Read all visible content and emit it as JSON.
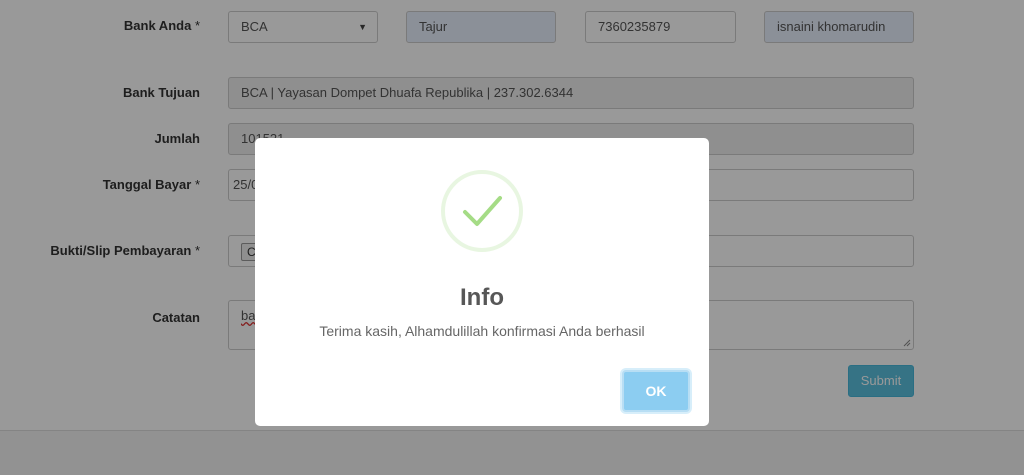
{
  "form": {
    "bank_anda": {
      "label": "Bank Anda",
      "required_mark": "*",
      "bank_select": "BCA",
      "branch": "Tajur",
      "account_number": "7360235879",
      "account_name": "isnaini khomarudin"
    },
    "bank_tujuan": {
      "label": "Bank Tujuan",
      "value": "BCA | Yayasan Dompet Dhuafa Republika | 237.302.6344"
    },
    "jumlah": {
      "label": "Jumlah",
      "value": "101521"
    },
    "tanggal_bayar": {
      "label": "Tanggal Bayar",
      "required_mark": "*",
      "value": "25/0"
    },
    "bukti": {
      "label": "Bukti/Slip Pembayaran",
      "required_mark": "*",
      "file_button": "C"
    },
    "catatan": {
      "label": "Catatan",
      "value": "ba"
    },
    "submit_label": "Submit"
  },
  "dialog": {
    "title": "Info",
    "message": "Terima kasih, Alhamdulillah konfirmasi Anda berhasil",
    "ok_label": "OK",
    "icon": "check-icon"
  },
  "colors": {
    "submit": "#5bc0de",
    "ok_button": "#8ccdf1",
    "check": "#a5dc86",
    "autofill": "#e8f0fe"
  }
}
